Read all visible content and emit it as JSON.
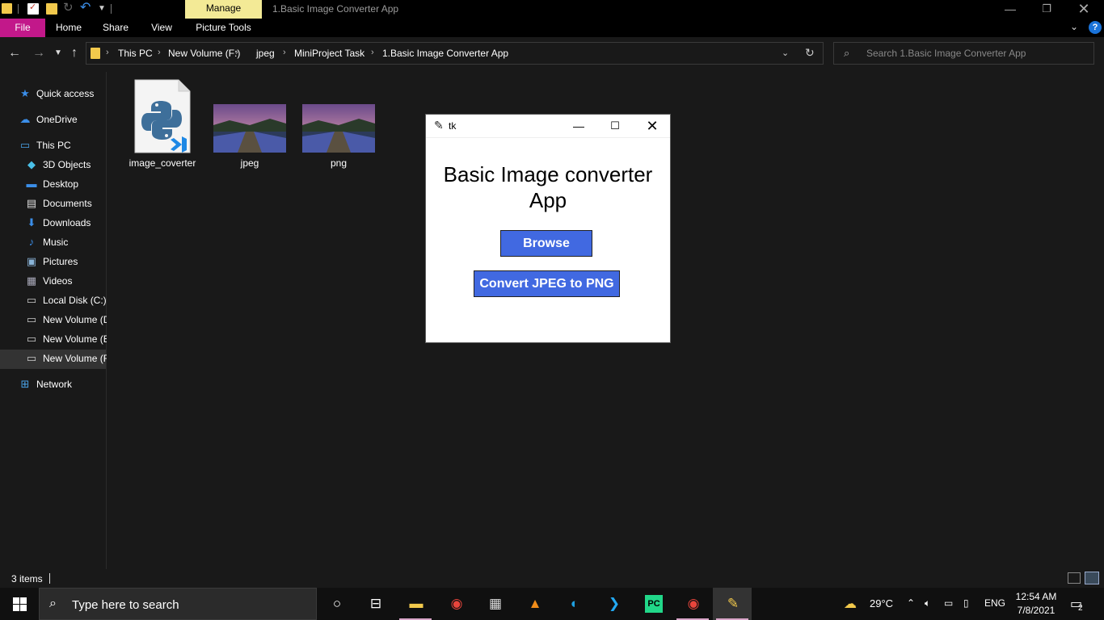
{
  "titlebar": {
    "manage_tab": "Manage",
    "window_title": "1.Basic Image Converter App"
  },
  "ribbon": {
    "tabs": [
      "File",
      "Home",
      "Share",
      "View",
      "Picture Tools"
    ],
    "help": "?"
  },
  "address": {
    "crumbs": [
      "This PC",
      "New Volume (F:)",
      "jpeg",
      "MiniProject Task",
      "1.Basic Image Converter App"
    ],
    "search_placeholder": "Search 1.Basic Image Converter App"
  },
  "navpane": {
    "items": [
      {
        "label": "Quick access",
        "icon": "star-icon"
      },
      {
        "label": "OneDrive",
        "icon": "cloud-icon"
      },
      {
        "label": "This PC",
        "icon": "computer-icon"
      },
      {
        "label": "3D Objects",
        "icon": "cube-icon"
      },
      {
        "label": "Desktop",
        "icon": "desktop-icon"
      },
      {
        "label": "Documents",
        "icon": "document-icon"
      },
      {
        "label": "Downloads",
        "icon": "download-icon"
      },
      {
        "label": "Music",
        "icon": "music-icon"
      },
      {
        "label": "Pictures",
        "icon": "picture-icon"
      },
      {
        "label": "Videos",
        "icon": "video-icon"
      },
      {
        "label": "Local Disk (C:)",
        "icon": "drive-icon"
      },
      {
        "label": "New Volume (D",
        "icon": "drive-icon"
      },
      {
        "label": "New Volume (E",
        "icon": "drive-icon"
      },
      {
        "label": "New Volume (F",
        "icon": "drive-icon"
      },
      {
        "label": "Network",
        "icon": "network-icon"
      }
    ]
  },
  "files": [
    {
      "name": "image_coverter",
      "type": "python-vscode-file-icon"
    },
    {
      "name": "jpeg",
      "type": "image-thumbnail"
    },
    {
      "name": "png",
      "type": "image-thumbnail"
    }
  ],
  "status": {
    "item_count": "3 items"
  },
  "tk_window": {
    "title": "tk",
    "heading": "Basic Image converter App",
    "browse_button": "Browse",
    "convert_button": "Convert JPEG to PNG",
    "button_color": "#4169e1"
  },
  "taskbar": {
    "search_placeholder": "Type here to search",
    "apps": [
      "cortana-icon",
      "task-view-icon",
      "file-explorer-icon",
      "chrome-icon",
      "store-icon",
      "vlc-icon",
      "edge-icon",
      "vscode-icon",
      "pycharm-icon",
      "chrome-profile-icon",
      "python-icon"
    ],
    "temperature": "29°C",
    "language": "ENG",
    "time": "12:54 AM",
    "date": "7/8/2021",
    "notification_count": "2"
  }
}
